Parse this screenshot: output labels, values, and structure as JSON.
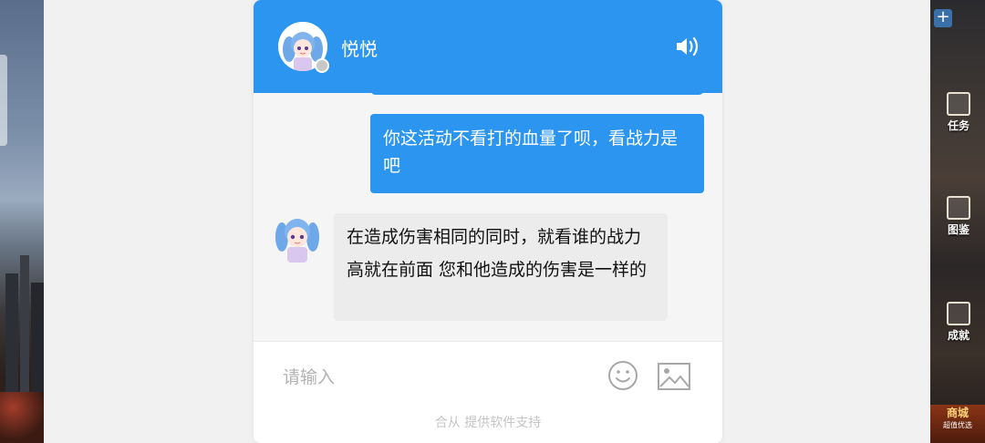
{
  "header": {
    "agent_name": "悦悦",
    "avatar_icon": "anime-girl-avatar",
    "status_icon": "offline-status-dot",
    "sound_icon": "speaker-icon"
  },
  "messages": [
    {
      "direction": "out",
      "text": "你这活动不看打的血量了呗，看战力是吧"
    },
    {
      "direction": "in",
      "text": "在造成伤害相同的同时，就看谁的战力高就在前面 您和他造成的伤害是一样的",
      "avatar_icon": "anime-girl-avatar"
    }
  ],
  "composer": {
    "placeholder": "请输入",
    "emoji_icon": "smile-icon",
    "image_icon": "image-icon"
  },
  "footer": {
    "powered_by": "合从 提供软件支持"
  },
  "game_sidebar": {
    "items": [
      {
        "label": "任务",
        "icon": "task-icon"
      },
      {
        "label": "图鉴",
        "icon": "handbook-icon"
      },
      {
        "label": "成就",
        "icon": "achievement-icon"
      }
    ],
    "shop_label": "商城",
    "shop_sub": "超值优选"
  },
  "colors": {
    "accent": "#2c95f0",
    "incoming_bubble": "#ececec",
    "background": "#f1f1f1"
  }
}
